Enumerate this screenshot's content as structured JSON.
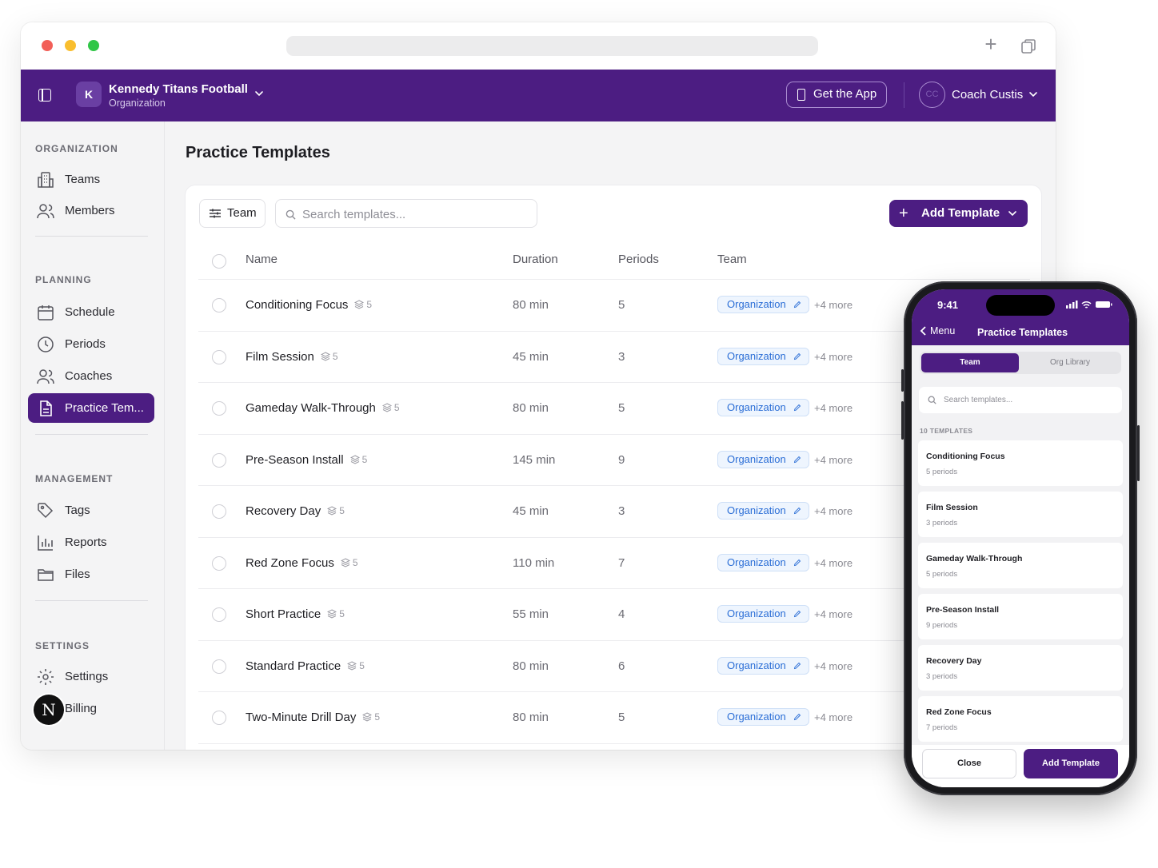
{
  "topbar": {
    "org_initial": "K",
    "org_name": "Kennedy Titans Football",
    "org_subtitle": "Organization",
    "get_app_label": "Get the App",
    "user_initials": "CC",
    "user_name": "Coach Custis"
  },
  "sidebar": {
    "sections": [
      {
        "label": "ORGANIZATION",
        "items": [
          {
            "label": "Teams",
            "icon": "building-icon"
          },
          {
            "label": "Members",
            "icon": "users-icon"
          }
        ]
      },
      {
        "label": "PLANNING",
        "items": [
          {
            "label": "Schedule",
            "icon": "calendar-icon"
          },
          {
            "label": "Periods",
            "icon": "clock-icon"
          },
          {
            "label": "Coaches",
            "icon": "users-icon"
          },
          {
            "label": "Practice Tem...",
            "icon": "document-icon",
            "active": true
          }
        ]
      },
      {
        "label": "MANAGEMENT",
        "items": [
          {
            "label": "Tags",
            "icon": "tag-icon"
          },
          {
            "label": "Reports",
            "icon": "bar-chart-icon"
          },
          {
            "label": "Files",
            "icon": "folder-icon"
          }
        ]
      },
      {
        "label": "SETTINGS",
        "items": [
          {
            "label": "Settings",
            "icon": "gear-icon"
          },
          {
            "label": "Billing",
            "icon": "card-icon"
          }
        ]
      }
    ],
    "badge_letter": "N"
  },
  "main": {
    "title": "Practice Templates",
    "filter_label": "Team",
    "search_placeholder": "Search templates...",
    "add_label": "Add Template",
    "columns": {
      "name": "Name",
      "duration": "Duration",
      "periods": "Periods",
      "team": "Team"
    },
    "rows": [
      {
        "name": "Conditioning Focus",
        "count": "5",
        "duration": "80 min",
        "periods": "5",
        "team": "Organization",
        "more": "+4 more"
      },
      {
        "name": "Film Session",
        "count": "5",
        "duration": "45 min",
        "periods": "3",
        "team": "Organization",
        "more": "+4 more"
      },
      {
        "name": "Gameday Walk-Through",
        "count": "5",
        "duration": "80 min",
        "periods": "5",
        "team": "Organization",
        "more": "+4 more"
      },
      {
        "name": "Pre-Season Install",
        "count": "5",
        "duration": "145 min",
        "periods": "9",
        "team": "Organization",
        "more": "+4 more"
      },
      {
        "name": "Recovery Day",
        "count": "5",
        "duration": "45 min",
        "periods": "3",
        "team": "Organization",
        "more": "+4 more"
      },
      {
        "name": "Red Zone Focus",
        "count": "5",
        "duration": "110 min",
        "periods": "7",
        "team": "Organization",
        "more": "+4 more"
      },
      {
        "name": "Short Practice",
        "count": "5",
        "duration": "55 min",
        "periods": "4",
        "team": "Organization",
        "more": "+4 more"
      },
      {
        "name": "Standard Practice",
        "count": "5",
        "duration": "80 min",
        "periods": "6",
        "team": "Organization",
        "more": "+4 more"
      },
      {
        "name": "Two-Minute Drill Day",
        "count": "5",
        "duration": "80 min",
        "periods": "5",
        "team": "Organization",
        "more": "+4 more"
      }
    ]
  },
  "phone": {
    "time": "9:41",
    "back_label": "Menu",
    "title": "Practice Templates",
    "tab_team": "Team",
    "tab_library": "Org Library",
    "search_placeholder": "Search templates...",
    "count_label": "10 TEMPLATES",
    "items": [
      {
        "title": "Conditioning Focus",
        "sub": "5 periods"
      },
      {
        "title": "Film Session",
        "sub": "3 periods"
      },
      {
        "title": "Gameday Walk-Through",
        "sub": "5 periods"
      },
      {
        "title": "Pre-Season Install",
        "sub": "9 periods"
      },
      {
        "title": "Recovery Day",
        "sub": "3 periods"
      },
      {
        "title": "Red Zone Focus",
        "sub": "7 periods"
      }
    ],
    "close_label": "Close",
    "add_label": "Add Template"
  },
  "colors": {
    "brand": "#4c1d82",
    "tag_text": "#2b6ed6",
    "tag_bg": "#eef5fe"
  }
}
